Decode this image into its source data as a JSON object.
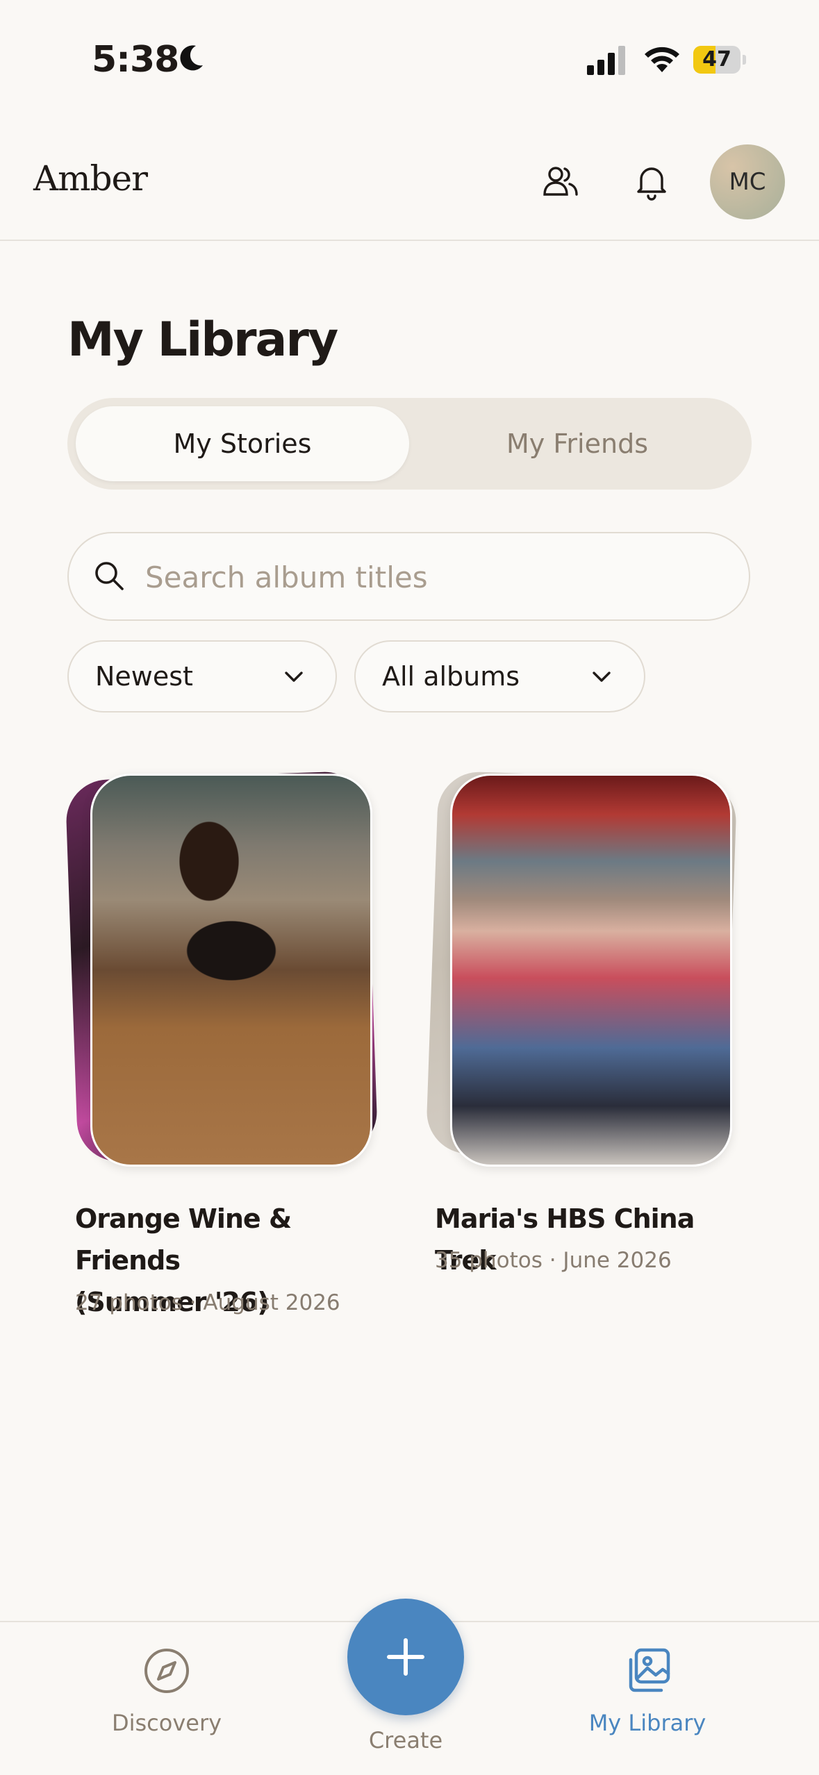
{
  "status_bar": {
    "time": "5:38",
    "battery_level": "47",
    "battery_fraction": 0.47
  },
  "header": {
    "brand": "Amber",
    "avatar_initials": "MC"
  },
  "page_title": "My Library",
  "segments": {
    "active": "My Stories",
    "inactive": "My Friends"
  },
  "search": {
    "placeholder": "Search album titles",
    "value": ""
  },
  "filters": {
    "sort": "Newest",
    "scope": "All albums"
  },
  "albums": [
    {
      "title_line1": "Orange Wine & Friends",
      "title_line2": "(Summer '26)",
      "meta": "27 photos · August 2026"
    },
    {
      "title_line1": "Maria's HBS China Trek",
      "meta": "35 photos · June 2026"
    }
  ],
  "nav": {
    "discovery": "Discovery",
    "create": "Create",
    "library": "My Library"
  },
  "colors": {
    "accent": "#4a86c0",
    "background": "#faf8f5",
    "muted_text": "#877c70"
  },
  "icons": [
    "moon-icon",
    "cellular-signal-icon",
    "wifi-icon",
    "battery-icon",
    "friends-icon",
    "bell-icon",
    "search-icon",
    "chevron-down-icon",
    "compass-icon",
    "plus-icon",
    "photo-library-icon"
  ]
}
